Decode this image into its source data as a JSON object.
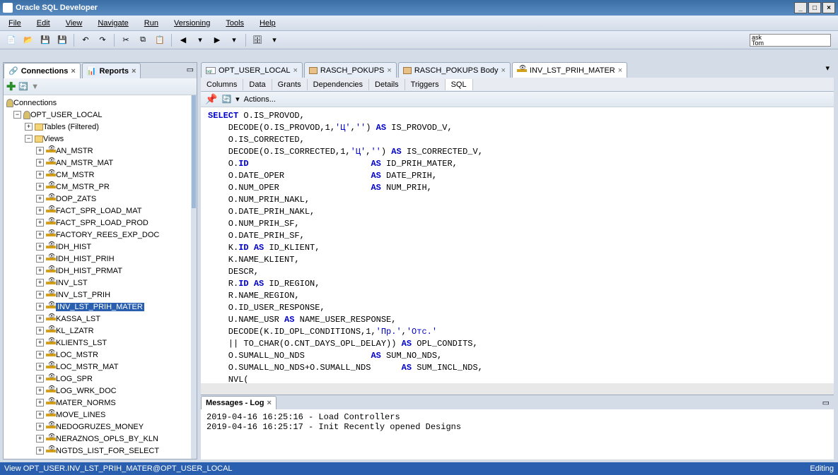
{
  "titlebar": {
    "title": "Oracle SQL Developer"
  },
  "menu": {
    "file": "File",
    "edit": "Edit",
    "view": "View",
    "navigate": "Navigate",
    "run": "Run",
    "versioning": "Versioning",
    "tools": "Tools",
    "help": "Help"
  },
  "sidebar": {
    "connections_tab": "Connections",
    "reports_tab": "Reports",
    "root": "Connections",
    "conn": "OPT_USER_LOCAL",
    "tables": "Tables (Filtered)",
    "views": "Views",
    "view_items": [
      "AN_MSTR",
      "AN_MSTR_MAT",
      "CM_MSTR",
      "CM_MSTR_PR",
      "DOP_ZATS",
      "FACT_SPR_LOAD_MAT",
      "FACT_SPR_LOAD_PROD",
      "FACTORY_REES_EXP_DOC",
      "IDH_HIST",
      "IDH_HIST_PRIH",
      "IDH_HIST_PRMAT",
      "INV_LST",
      "INV_LST_PRIH",
      "INV_LST_PRIH_MATER",
      "KASSA_LST",
      "KL_LZATR",
      "KLIENTS_LST",
      "LOC_MSTR",
      "LOC_MSTR_MAT",
      "LOG_SPR",
      "LOG_WRK_DOC",
      "MATER_NORMS",
      "MOVE_LINES",
      "NEDOGRUZES_MONEY",
      "NERAZNOS_OPLS_BY_KLN",
      "NGTDS_LIST_FOR_SELECT"
    ],
    "selected_index": 13
  },
  "editor": {
    "tabs": [
      "OPT_USER_LOCAL",
      "RASCH_POKUPS",
      "RASCH_POKUPS Body",
      "INV_LST_PRIH_MATER"
    ],
    "active_tab_index": 3,
    "subtabs": [
      "Columns",
      "Data",
      "Grants",
      "Dependencies",
      "Details",
      "Triggers",
      "SQL"
    ],
    "active_subtab_index": 6,
    "pin_tooltip": "Pin",
    "actions_label": "Actions..."
  },
  "messages": {
    "title": "Messages - Log",
    "lines": [
      "2019-04-16 16:25:16 - Load Controllers",
      "2019-04-16 16:25:17 - Init Recently opened Designs"
    ]
  },
  "statusbar": {
    "left": "View OPT_USER.INV_LST_PRIH_MATER@OPT_USER_LOCAL",
    "right": "Editing"
  },
  "searchbox": {
    "line1": "ask",
    "line2": "Tom"
  },
  "code_lines": [
    {
      "t": "SELECT O.IS_PROVOD,",
      "kw_at": [
        0
      ]
    },
    {
      "t": "    DECODE(O.IS_PROVOD,1,'Ц','') AS IS_PROVOD_V,",
      "kw_pos": [
        "AS"
      ],
      "str": [
        "'Ц'",
        "''"
      ]
    },
    {
      "t": "    O.IS_CORRECTED,"
    },
    {
      "t": "    DECODE(O.IS_CORRECTED,1,'Ц','') AS IS_CORRECTED_V,",
      "kw_pos": [
        "AS"
      ],
      "str": [
        "'Ц'",
        "''"
      ]
    },
    {
      "t": "    O.ID                        AS ID_PRIH_MATER,",
      "kw_pos": [
        "AS"
      ],
      "id": [
        "ID"
      ]
    },
    {
      "t": "    O.DATE_OPER                 AS DATE_PRIH,",
      "kw_pos": [
        "AS"
      ]
    },
    {
      "t": "    O.NUM_OPER                  AS NUM_PRIH,",
      "kw_pos": [
        "AS"
      ]
    },
    {
      "t": "    O.NUM_PRIH_NAKL,"
    },
    {
      "t": "    O.DATE_PRIH_NAKL,"
    },
    {
      "t": "    O.NUM_PRIH_SF,"
    },
    {
      "t": "    O.DATE_PRIH_SF,"
    },
    {
      "t": "    K.ID AS ID_KLIENT,",
      "kw_pos": [
        "AS"
      ],
      "id": [
        "ID"
      ]
    },
    {
      "t": "    K.NAME_KLIENT,"
    },
    {
      "t": "    DESCR,"
    },
    {
      "t": "    R.ID AS ID_REGION,",
      "kw_pos": [
        "AS"
      ],
      "id": [
        "ID"
      ]
    },
    {
      "t": "    R.NAME_REGION,"
    },
    {
      "t": "    O.ID_USER_RESPONSE,"
    },
    {
      "t": "    U.NAME_USR AS NAME_USER_RESPONSE,",
      "kw_pos": [
        "AS"
      ]
    },
    {
      "t": "    DECODE(K.ID_OPL_CONDITIONS,1,'Пр.','Отс.'",
      "str": [
        "'Пр.'",
        "'Отс.'"
      ]
    },
    {
      "t": "    || TO_CHAR(O.CNT_DAYS_OPL_DELAY)) AS OPL_CONDITS,",
      "kw_pos": [
        "AS"
      ]
    },
    {
      "t": "    O.SUMALL_NO_NDS             AS SUM_NO_NDS,",
      "kw_pos": [
        "AS"
      ]
    },
    {
      "t": "    O.SUMALL_NO_NDS+O.SUMALL_NDS      AS SUM_INCL_NDS,",
      "kw_pos": [
        "AS"
      ]
    },
    {
      "t": "    NVL("
    }
  ]
}
